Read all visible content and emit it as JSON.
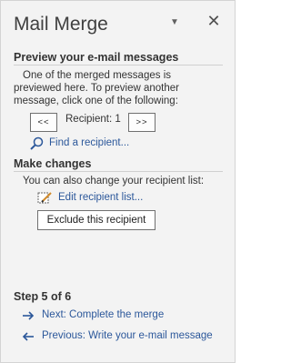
{
  "pane": {
    "title": "Mail Merge",
    "pin_icon": "chevron-down-icon",
    "close_icon": "close-icon"
  },
  "preview": {
    "heading": "Preview your e-mail messages",
    "line1": "One of the merged messages is",
    "line2": "previewed here. To preview another",
    "line3": "message, click one of the following:",
    "prev_label": "<<",
    "recipient_label": "Recipient: 1",
    "next_label": ">>",
    "find_label": "Find a recipient..."
  },
  "changes": {
    "heading": "Make changes",
    "description": "You can also change your recipient list:",
    "edit_label": "Edit recipient list...",
    "exclude_label": "Exclude this recipient"
  },
  "footer": {
    "step": "Step 5 of 6",
    "next_label": "Next: Complete the merge",
    "prev_label": "Previous: Write your e-mail message"
  },
  "colors": {
    "link": "#2b579a",
    "background": "#f3f3f3"
  }
}
